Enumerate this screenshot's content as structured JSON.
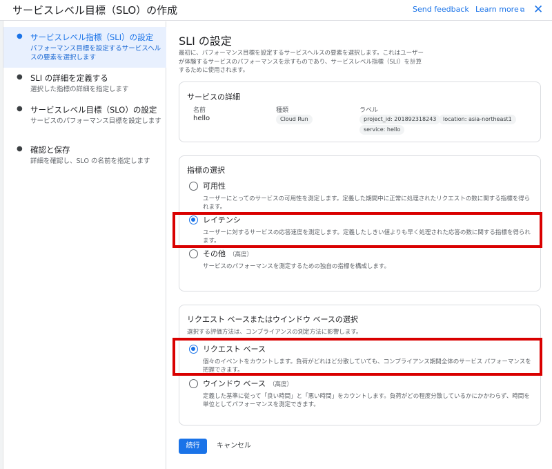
{
  "header": {
    "title": "サービスレベル目標（SLO）の作成",
    "feedback": "Send feedback",
    "learn_more": "Learn more",
    "external_icon": "⧉",
    "close_icon": "✕"
  },
  "stepper": {
    "steps": [
      {
        "title": "サービスレベル指標（SLI）の設定",
        "desc": "パフォーマンス目標を設定するサービスヘルスの要素を選択します",
        "active": true
      },
      {
        "title": "SLI の詳細を定義する",
        "desc": "選択した指標の詳細を指定します",
        "active": false
      },
      {
        "title": "サービスレベル目標（SLO）の設定",
        "desc": "サービスのパフォーマンス目標を設定します",
        "active": false
      },
      {
        "title": "確認と保存",
        "desc": "詳細を確認し、SLO の名前を指定します",
        "active": false
      }
    ]
  },
  "main": {
    "title": "SLI の設定",
    "description": "最初に、パフォーマンス目標を設定するサービスヘルスの要素を選択します。これはユーザーが体験するサービスのパフォーマンスを示すものであり、サービスレベル指標（SLI）を計算するために使用されます。",
    "service_details": {
      "title": "サービスの詳細",
      "name_label": "名前",
      "name_value": "hello",
      "type_label": "種類",
      "type_value": "Cloud Run",
      "labels_label": "ラベル",
      "labels": [
        "project_id: 201892318243",
        "location: asia-northeast1",
        "service: hello"
      ]
    },
    "metric_selection": {
      "title": "指標の選択",
      "options": [
        {
          "label": "可用性",
          "sub": "",
          "desc": "ユーザーにとってのサービスの可用性を測定します。定義した期間中に正常に処理されたリクエストの数に関する指標を得られます。",
          "checked": false
        },
        {
          "label": "レイテンシ",
          "sub": "",
          "desc": "ユーザーに対するサービスの応答速度を測定します。定義したしきい値よりも早く処理された応答の数に関する指標を得られます。",
          "checked": true
        },
        {
          "label": "その他",
          "sub": "（高度）",
          "desc": "サービスのパフォーマンスを測定するための独自の指標を構成します。",
          "checked": false
        }
      ]
    },
    "evaluation": {
      "title": "リクエスト ベースまたはウインドウ ベースの選択",
      "subtitle": "選択する評価方法は、コンプライアンスの測定方法に影響します。",
      "options": [
        {
          "label": "リクエスト ベース",
          "sub": "",
          "desc": "個々のイベントをカウントします。負荷がどれほど分散していても、コンプライアンス期間全体のサービス パフォーマンスを把握できます。",
          "checked": true
        },
        {
          "label": "ウインドウ ベース",
          "sub": "（高度）",
          "desc": "定義した基準に従って「良い時間」と「悪い時間」をカウントします。負荷がどの程度分散しているかにかかわらず、時間を単位としてパフォーマンスを測定できます。",
          "checked": false
        }
      ]
    },
    "continue_label": "続行",
    "cancel_label": "キャンセル"
  },
  "colors": {
    "accent": "#1a73e8",
    "highlight_box": "#d90000",
    "active_step_bg": "#e8f0fe"
  }
}
